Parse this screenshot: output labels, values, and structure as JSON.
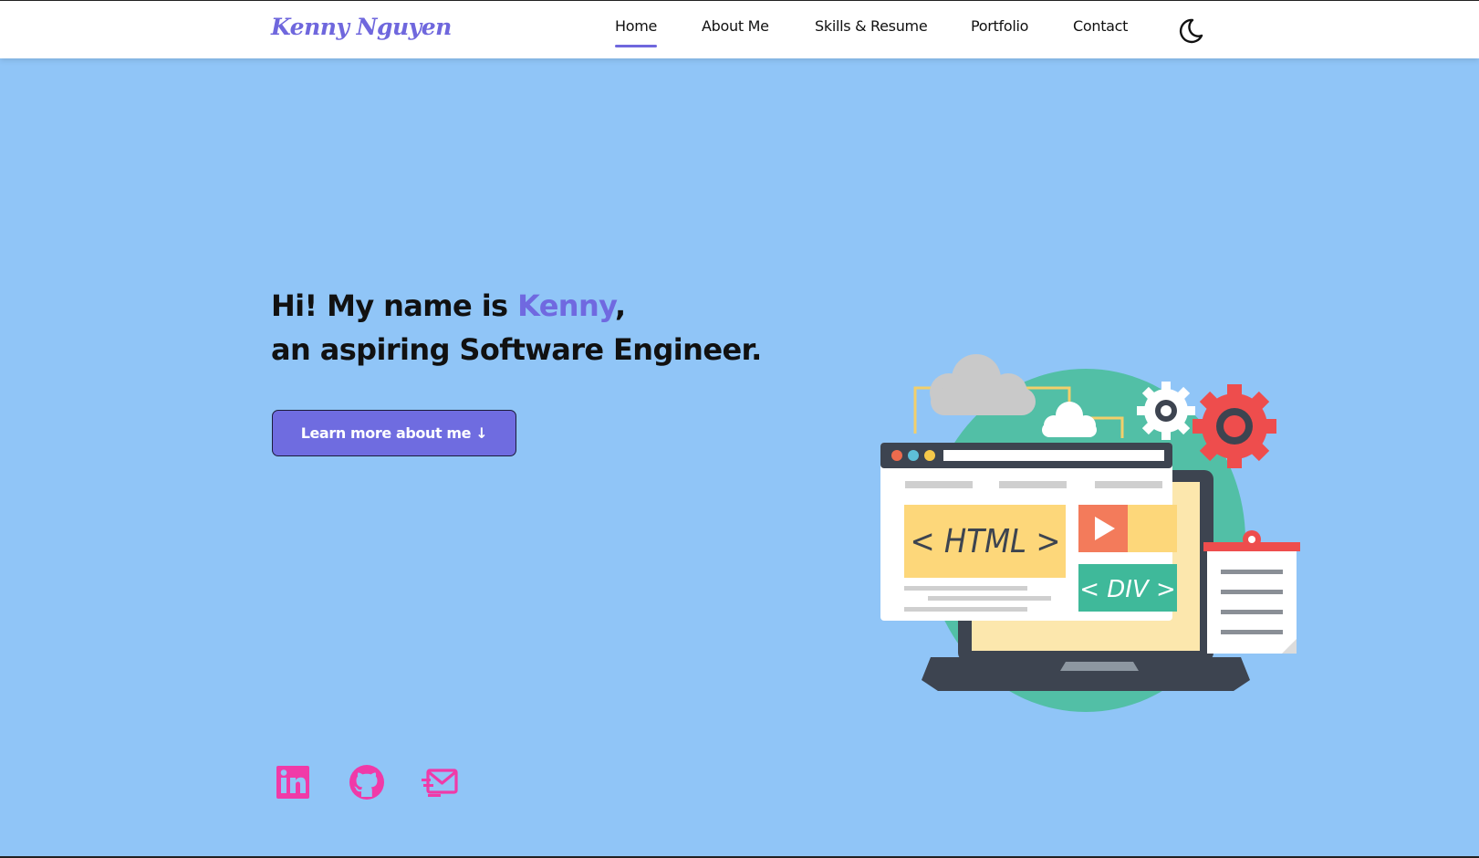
{
  "header": {
    "logo": "Kenny Nguyen",
    "nav": [
      {
        "label": "Home",
        "active": true
      },
      {
        "label": "About Me",
        "active": false
      },
      {
        "label": "Skills & Resume",
        "active": false
      },
      {
        "label": "Portfolio",
        "active": false
      },
      {
        "label": "Contact",
        "active": false
      }
    ],
    "theme_toggle_icon": "moon-icon"
  },
  "hero": {
    "line1_prefix": "Hi! My name is ",
    "name": "Kenny",
    "line1_suffix": ",",
    "line2": "an aspiring Software Engineer.",
    "cta_label": "Learn more about me ↓"
  },
  "illustration": {
    "html_tag": "< HTML >",
    "div_tag": "< DIV >"
  },
  "socials": [
    {
      "icon": "linkedin-icon"
    },
    {
      "icon": "github-icon"
    },
    {
      "icon": "email-icon"
    }
  ],
  "colors": {
    "background": "#90c5f7",
    "accent": "#6f67dd",
    "social": "#f03aa8"
  }
}
